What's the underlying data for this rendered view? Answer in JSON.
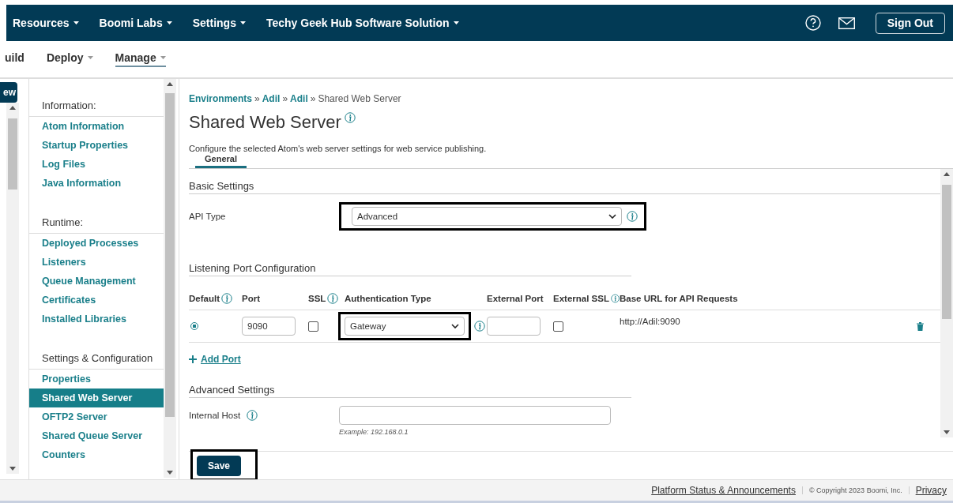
{
  "top_nav": {
    "menus": [
      {
        "label": "Resources"
      },
      {
        "label": "Boomi Labs"
      },
      {
        "label": "Settings"
      },
      {
        "label": "Techy Geek Hub Software Solution"
      }
    ],
    "sign_out": "Sign Out"
  },
  "sub_nav": {
    "items": [
      {
        "label": "uild",
        "selected": false,
        "caret": false
      },
      {
        "label": "Deploy",
        "selected": false,
        "caret": true
      },
      {
        "label": "Manage",
        "selected": true,
        "caret": true
      }
    ]
  },
  "left_strip": {
    "button": "ew"
  },
  "sidebar": {
    "sections": [
      {
        "title": "Information:",
        "items": [
          {
            "label": "Atom Information",
            "selected": false
          },
          {
            "label": "Startup Properties",
            "selected": false
          },
          {
            "label": "Log Files",
            "selected": false
          },
          {
            "label": "Java Information",
            "selected": false
          }
        ]
      },
      {
        "title": "Runtime:",
        "items": [
          {
            "label": "Deployed Processes",
            "selected": false
          },
          {
            "label": "Listeners",
            "selected": false
          },
          {
            "label": "Queue Management",
            "selected": false
          },
          {
            "label": "Certificates",
            "selected": false
          },
          {
            "label": "Installed Libraries",
            "selected": false
          }
        ]
      },
      {
        "title": "Settings & Configuration",
        "items": [
          {
            "label": "Properties",
            "selected": false
          },
          {
            "label": "Shared Web Server",
            "selected": true
          },
          {
            "label": "OFTP2 Server",
            "selected": false
          },
          {
            "label": "Shared Queue Server",
            "selected": false
          },
          {
            "label": "Counters",
            "selected": false
          }
        ]
      }
    ]
  },
  "breadcrumb": {
    "links": [
      "Environments",
      "Adil",
      "Adil"
    ],
    "separator": "»",
    "current": "Shared Web Server"
  },
  "title": "Shared Web Server",
  "description": "Configure the selected Atom's web server settings for web service publishing.",
  "tabs": [
    {
      "label": "General",
      "selected": true
    }
  ],
  "basic_settings": {
    "heading": "Basic Settings",
    "api_type": {
      "label": "API Type",
      "value": "Advanced",
      "highlighted": true
    }
  },
  "listening_ports": {
    "heading": "Listening Port Configuration",
    "columns": [
      {
        "label": "Default",
        "info": true
      },
      {
        "label": "Port",
        "info": false
      },
      {
        "label": "SSL",
        "info": true
      },
      {
        "label": "Authentication Type",
        "info": false
      },
      {
        "label": "External Port",
        "info": false
      },
      {
        "label": "External SSL",
        "info": true
      },
      {
        "label": "Base URL for API Requests",
        "info": false
      }
    ],
    "rows": [
      {
        "default": true,
        "port": "9090",
        "ssl": false,
        "authentication_type": "Gateway",
        "auth_highlighted": true,
        "external_port": "",
        "external_ssl": false,
        "base_url": "http://Adil:9090"
      }
    ],
    "add_port": "Add Port"
  },
  "advanced_settings": {
    "heading": "Advanced Settings",
    "internal_host": {
      "label": "Internal Host",
      "hint": "Example: 192.168.0.1"
    }
  },
  "save": {
    "label": "Save",
    "highlighted": true
  },
  "footer": {
    "status_link": "Platform Status & Announcements",
    "copyright": "© Copyright 2023 Boomi, Inc.",
    "privacy_link": "Privacy"
  }
}
